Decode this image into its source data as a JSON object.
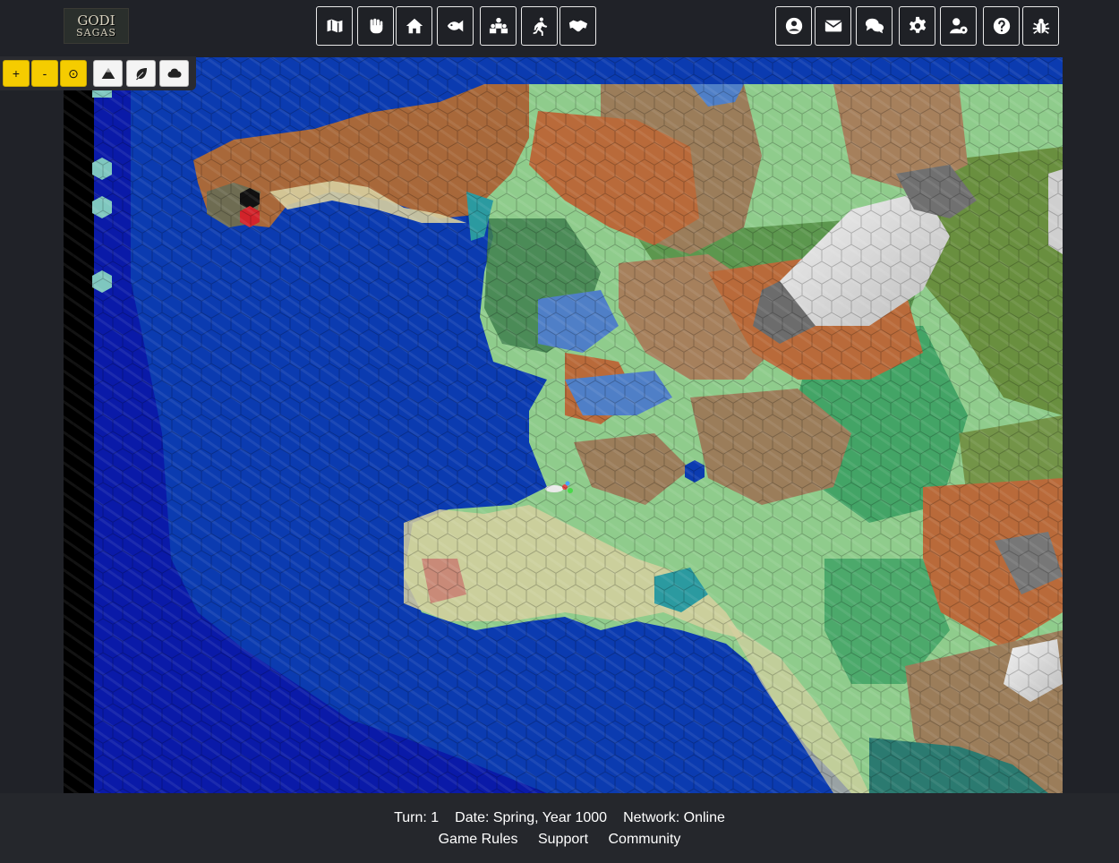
{
  "logo": {
    "line1": "GODI",
    "line2": "SAGAS"
  },
  "toolbar_center": [
    {
      "name": "map-icon"
    },
    {
      "name": "fist-icon"
    },
    {
      "name": "home-icon"
    },
    {
      "name": "fish-icon"
    },
    {
      "name": "people-group-icon"
    },
    {
      "name": "running-person-icon"
    },
    {
      "name": "handshake-icon"
    }
  ],
  "toolbar_right": [
    {
      "name": "user-circle-icon"
    },
    {
      "name": "envelope-icon"
    },
    {
      "name": "chat-bubbles-icon"
    },
    {
      "name": "gear-icon"
    },
    {
      "name": "user-settings-icon"
    },
    {
      "name": "question-circle-icon"
    },
    {
      "name": "bug-icon"
    }
  ],
  "map_controls": {
    "zoom_in": "+",
    "zoom_out": "-",
    "center": "⊙",
    "layers": [
      {
        "name": "mountain-icon"
      },
      {
        "name": "leaf-icon"
      },
      {
        "name": "cloud-icon"
      }
    ]
  },
  "footer": {
    "turn": "Turn: 1",
    "date": "Date: Spring, Year 1000",
    "network": "Network: Online",
    "links": [
      "Game Rules",
      "Support",
      "Community"
    ]
  },
  "colors": {
    "deep_ocean": "#0a1aa8",
    "ocean": "#0b3bb0",
    "grassland": "#8fcc8c",
    "forest": "#3f7f4d",
    "hills": "#c06a36",
    "mountains": "#9b7d5a",
    "snow": "#e6e6e6",
    "beach": "#d6cf9f"
  }
}
